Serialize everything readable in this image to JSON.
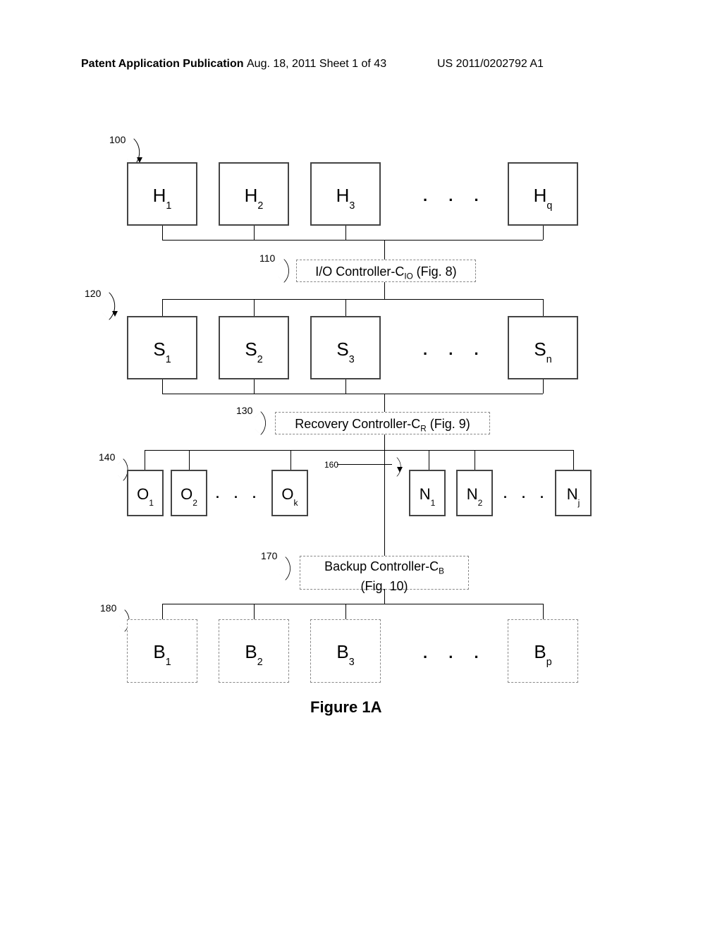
{
  "header": {
    "left": "Patent Application Publication",
    "mid": "Aug. 18, 2011  Sheet 1 of 43",
    "right": "US 2011/0202792 A1"
  },
  "refs": {
    "r100": "100",
    "r110": "110",
    "r120": "120",
    "r130": "130",
    "r140": "140",
    "r160": "160",
    "r170": "170",
    "r180": "180"
  },
  "rowH": {
    "b1": "H",
    "s1": "1",
    "b2": "H",
    "s2": "2",
    "b3": "H",
    "s3": "3",
    "b4": "H",
    "s4": "q"
  },
  "rowS": {
    "b1": "S",
    "s1": "1",
    "b2": "S",
    "s2": "2",
    "b3": "S",
    "s3": "3",
    "b4": "S",
    "s4": "n"
  },
  "rowO": {
    "b1": "O",
    "s1": "1",
    "b2": "O",
    "s2": "2",
    "b3": "O",
    "s3": "k"
  },
  "rowN": {
    "b1": "N",
    "s1": "1",
    "b2": "N",
    "s2": "2",
    "b3": "N",
    "s3": "j"
  },
  "rowB": {
    "b1": "B",
    "s1": "1",
    "b2": "B",
    "s2": "2",
    "b3": "B",
    "s3": "3",
    "b4": "B",
    "s4": "p"
  },
  "ctrl": {
    "io_pre": "I/O Controller-C",
    "io_sub": "IO",
    "io_post": " (Fig. 8)",
    "rec_pre": "Recovery Controller-C",
    "rec_sub": "R",
    "rec_post": " (Fig. 9)",
    "bk_pre": "Backup Controller-C",
    "bk_sub": "B",
    "bk_post": "(Fig. 10)"
  },
  "dots": ". . .",
  "caption": "Figure 1A"
}
